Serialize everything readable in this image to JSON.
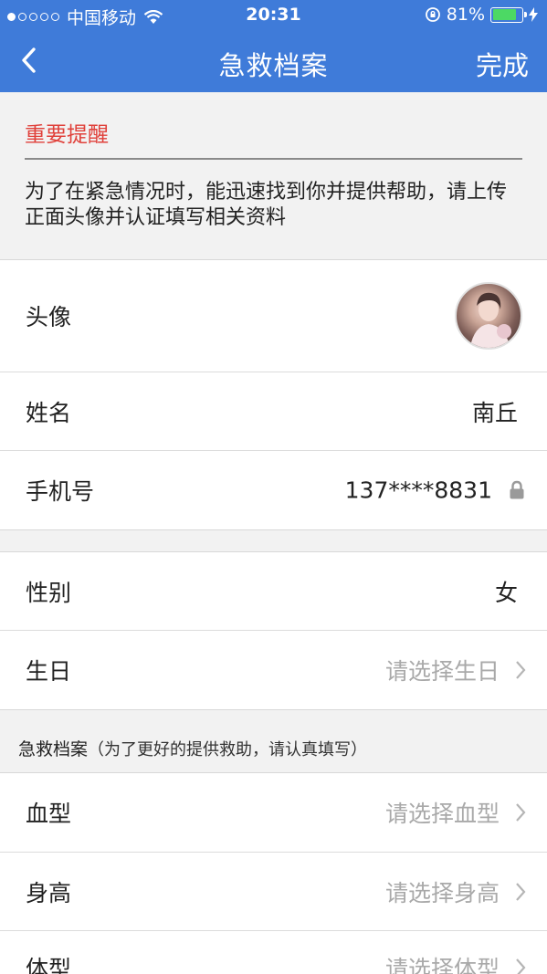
{
  "status_bar": {
    "carrier": "中国移动",
    "time": "20:31",
    "battery_percent": "81%",
    "signal_dots_filled": 1,
    "signal_dots_total": 5,
    "battery_level": 0.81,
    "battery_color": "#4cd964"
  },
  "nav": {
    "title": "急救档案",
    "done_label": "完成",
    "back_icon": "chevron-left-icon",
    "bar_color": "#3f7bd9"
  },
  "notice": {
    "heading": "重要提醒",
    "message": "为了在紧急情况时，能迅速找到你并提供帮助，请上传正面头像并认证填写相关资料",
    "heading_color": "#e0403a"
  },
  "profile": {
    "avatar_label": "头像",
    "name_label": "姓名",
    "name_value": "南丘",
    "phone_label": "手机号",
    "phone_value": "137****8831",
    "phone_icon": "lock-icon"
  },
  "basic": {
    "gender_label": "性别",
    "gender_value": "女",
    "birthday_label": "生日",
    "birthday_placeholder": "请选择生日"
  },
  "emergency": {
    "section_title": "急救档案",
    "section_note": "（为了更好的提供救助，请认真填写）",
    "blood_label": "血型",
    "blood_placeholder": "请选择血型",
    "height_label": "身高",
    "height_placeholder": "请选择身高",
    "body_label": "体型",
    "body_placeholder": "请选择体型"
  }
}
